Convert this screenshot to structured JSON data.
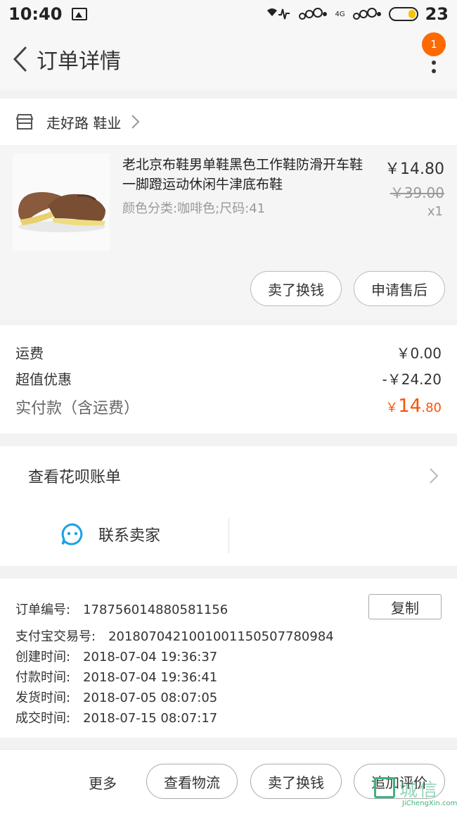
{
  "status_bar": {
    "time": "10:40",
    "battery_text": "23",
    "network": "4G"
  },
  "nav": {
    "title": "订单详情",
    "badge_count": "1"
  },
  "shop": {
    "name": "走好路 鞋业"
  },
  "product": {
    "title": "老北京布鞋男单鞋黑色工作鞋防滑开车鞋一脚蹬运动休闲牛津底布鞋",
    "spec": "颜色分类:咖啡色;尺码:41",
    "price_now": "￥14.80",
    "price_old": "￥39.00",
    "quantity": "x1",
    "buttons": {
      "sell": "卖了换钱",
      "after_sale": "申请售后"
    }
  },
  "fees": {
    "shipping_label": "运费",
    "shipping_value": "￥0.00",
    "discount_label": "超值优惠",
    "discount_value": "-￥24.20",
    "total_label": "实付款（含运费）",
    "total_currency": "￥",
    "total_int": "14",
    "total_dec": ".80"
  },
  "huabei": {
    "label": "查看花呗账单"
  },
  "contact": {
    "label": "联系卖家"
  },
  "order_info": {
    "copy_label": "复制",
    "rows": [
      {
        "key": "订单编号:",
        "value": "178756014880581156"
      },
      {
        "key": "支付宝交易号:",
        "value": "2018070421001001150507780984"
      },
      {
        "key": "创建时间:",
        "value": "2018-07-04 19:36:37"
      },
      {
        "key": "付款时间:",
        "value": "2018-07-04 19:36:41"
      },
      {
        "key": "发货时间:",
        "value": "2018-07-05 08:07:05"
      },
      {
        "key": "成交时间:",
        "value": "2018-07-15 08:07:17"
      }
    ]
  },
  "bottom": {
    "more": "更多",
    "logistics": "查看物流",
    "sell": "卖了换钱",
    "review": "追加评价"
  },
  "watermark": {
    "text": "城信",
    "sub": "JiChengXin.com"
  },
  "colors": {
    "accent": "#ff5000",
    "badge": "#ff6a00",
    "contact_icon": "#1ba1e6"
  }
}
